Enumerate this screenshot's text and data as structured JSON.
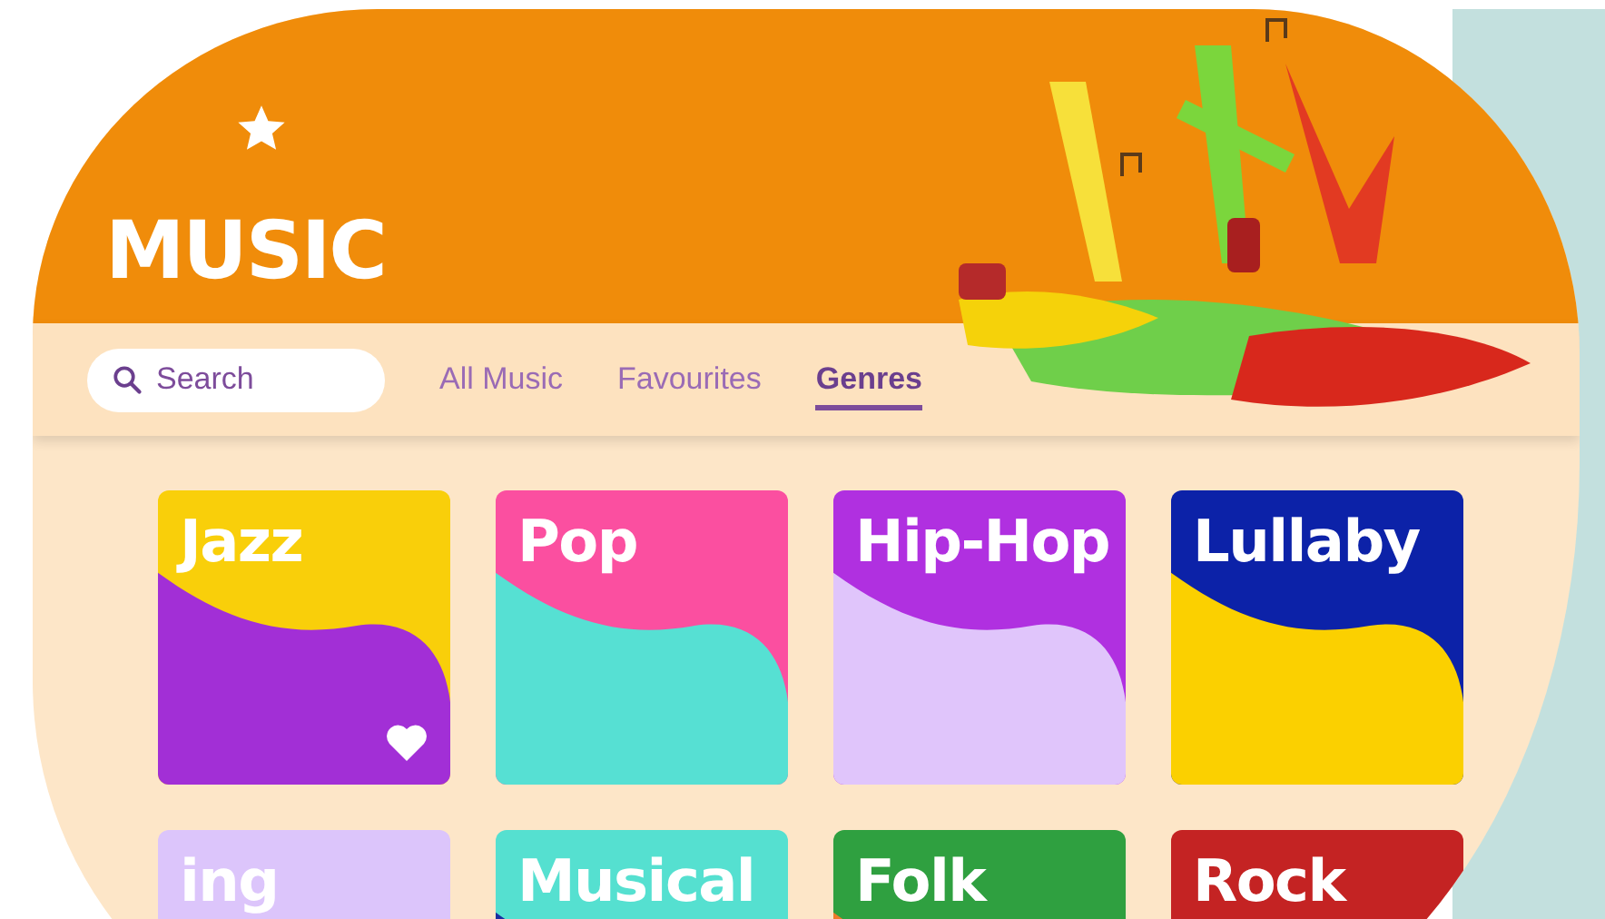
{
  "header": {
    "title": "MUSIC"
  },
  "search": {
    "placeholder": "Search"
  },
  "tabs": [
    {
      "label": "All Music",
      "selected": false
    },
    {
      "label": "Favourites",
      "selected": false
    },
    {
      "label": "Genres",
      "selected": true
    }
  ],
  "genres": [
    {
      "title": "Jazz",
      "color": "#f9cf0a",
      "wave": {
        "color": "#a22fd6"
      },
      "favourite": true
    },
    {
      "title": "Pop",
      "color": "#fb4fa0",
      "wave": {
        "color": "#56e0d3"
      },
      "favourite": false
    },
    {
      "title": "Hip-Hop",
      "color": "#b030e0",
      "wave": {
        "color": "#e0c5fb"
      },
      "favourite": false
    },
    {
      "title": "Lullaby",
      "color": "#0c22a8",
      "wave": {
        "color": "#fbd000"
      },
      "favourite": false
    },
    {
      "title": "ing",
      "color": "#dcc5fb"
    },
    {
      "title": "Musical",
      "color": "#55e0d0",
      "wave": {
        "color": "#1a2fa0"
      }
    },
    {
      "title": "Folk",
      "color": "#2fa040",
      "wave": {
        "color": "#f07a2a"
      }
    },
    {
      "title": "Rock",
      "color": "#c42323"
    }
  ]
}
